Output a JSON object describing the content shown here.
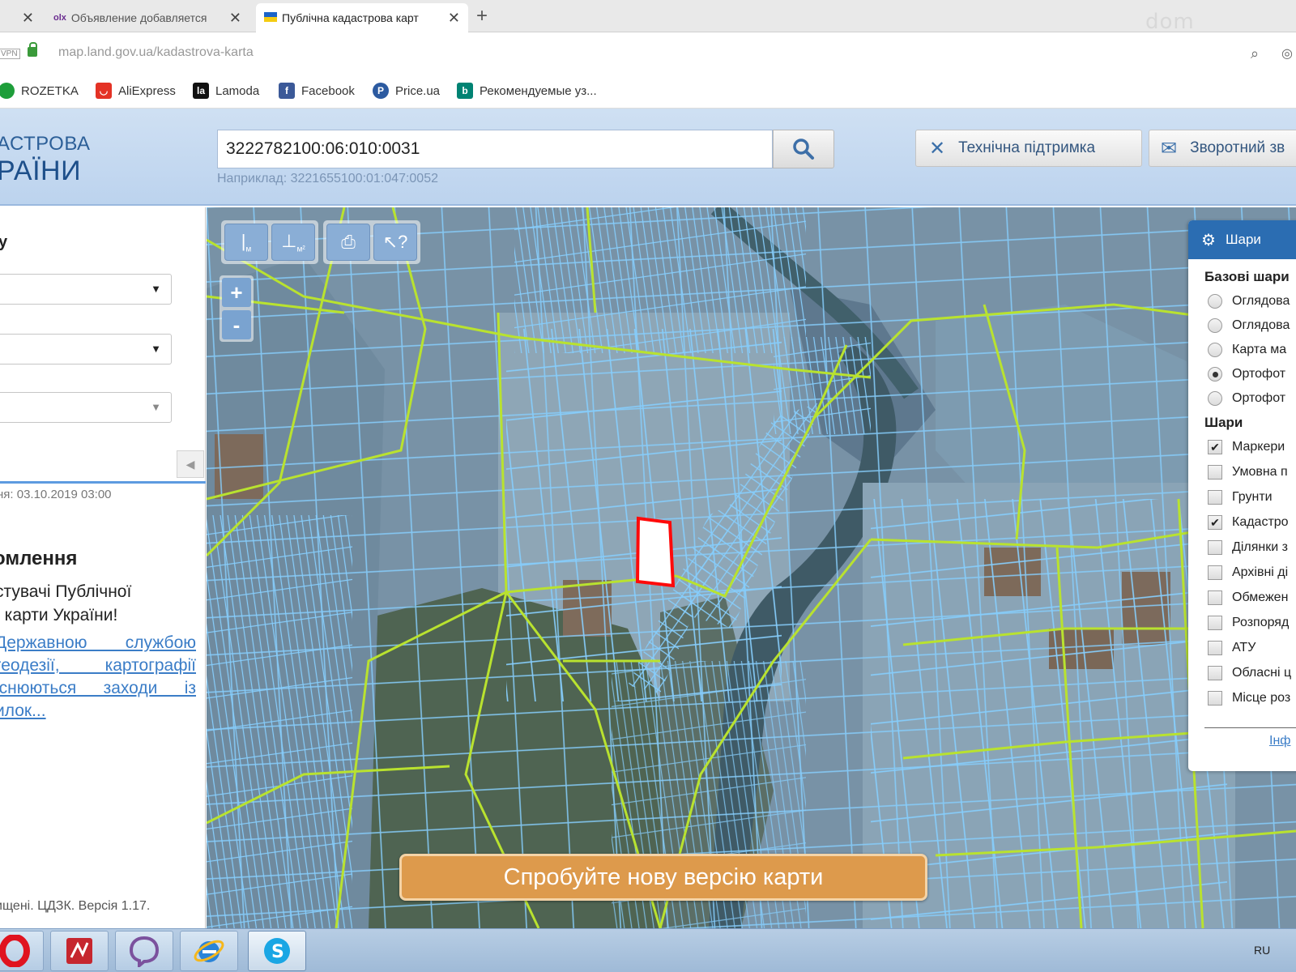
{
  "browser": {
    "tabs": [
      {
        "title": "",
        "close": "✕"
      },
      {
        "favicon": "olx",
        "title": "Объявление добавляется",
        "close": "✕"
      },
      {
        "title": "Публічна кадастрова карт",
        "close": "✕",
        "active": true
      }
    ],
    "new_tab": "+",
    "watermark": "dom",
    "vpn": "VPN",
    "url": {
      "host": "map.land.gov.ua",
      "path": "/kadastrova-karta"
    },
    "bookmarks": [
      {
        "label": "ROZETKA",
        "icon": "rozetka-icon",
        "color": "#1e9e3a"
      },
      {
        "label": "AliExpress",
        "icon": "aliexpress-icon",
        "color": "#e43225"
      },
      {
        "label": "Lamoda",
        "icon": "lamoda-icon",
        "color": "#111111"
      },
      {
        "label": "Facebook",
        "icon": "facebook-icon",
        "color": "#3b5998"
      },
      {
        "label": "Price.ua",
        "icon": "priceua-icon",
        "color": "#2c5aa0"
      },
      {
        "label": "Рекомендуемые уз...",
        "icon": "bing-icon",
        "color": "#008373"
      }
    ]
  },
  "header": {
    "logo_line1": "АСТРОВА",
    "logo_line2": "РАЇНИ",
    "search_value": "3222782100:06:010:0031",
    "search_hint": "Наприклад: 3221655100:01:047:0052",
    "support_label": "Технічна підтримка",
    "feedback_label": "Зворотний зв"
  },
  "left_panel": {
    "title": "у",
    "update_date": "ня: 03.10.2019 03:00",
    "notice_title": "омлення",
    "notice_text": "стувачі Публічної\nї карти України!",
    "notice_link": "Державною службою геодезії, картографії існюються заходи із илок...",
    "copyright": "ищені. ЦДЗК. Версія 1.17.",
    "collapse": "◀"
  },
  "map": {
    "tools": [
      {
        "name": "measure-distance-button",
        "glyph": "|ₘ"
      },
      {
        "name": "measure-area-button",
        "glyph": "⊥ₘ²"
      },
      {
        "name": "print-button",
        "glyph": "🖶"
      },
      {
        "name": "identify-button",
        "glyph": "↖?"
      }
    ],
    "zoom_in": "+",
    "zoom_out": "-",
    "banner": "Спробуйте нову версію карти",
    "colors": {
      "parcel_outline": "#7ec8ff",
      "boundary": "#b7e02e",
      "selected_fill": "#ffffff",
      "selected_outline": "#ff0000",
      "banner": "#dd9a4c"
    }
  },
  "layers": {
    "title": "Шари",
    "base_heading": "Базові шари",
    "base_layers": [
      {
        "label": "Оглядова",
        "selected": false
      },
      {
        "label": "Оглядова",
        "selected": false
      },
      {
        "label": "Карта ма",
        "selected": false
      },
      {
        "label": "Ортофот",
        "selected": true
      },
      {
        "label": "Ортофот",
        "selected": false
      }
    ],
    "overlays_heading": "Шари",
    "overlays": [
      {
        "label": "Маркери",
        "checked": true
      },
      {
        "label": "Умовна п",
        "checked": false
      },
      {
        "label": "Грунти",
        "checked": false
      },
      {
        "label": "Кадастро",
        "checked": true
      },
      {
        "label": "Ділянки з",
        "checked": false
      },
      {
        "label": "Архівні ді",
        "checked": false
      },
      {
        "label": "Обмежен",
        "checked": false
      },
      {
        "label": "Розпоряд",
        "checked": false
      },
      {
        "label": "АТУ",
        "checked": false
      },
      {
        "label": "Обласні ц",
        "checked": false
      },
      {
        "label": "Місце роз",
        "checked": false
      }
    ],
    "info_link": "Інф"
  },
  "taskbar": {
    "apps": [
      "opera-icon",
      "pdf-icon",
      "viber-icon",
      "ie-icon",
      "skype-icon"
    ],
    "lang": "RU"
  }
}
